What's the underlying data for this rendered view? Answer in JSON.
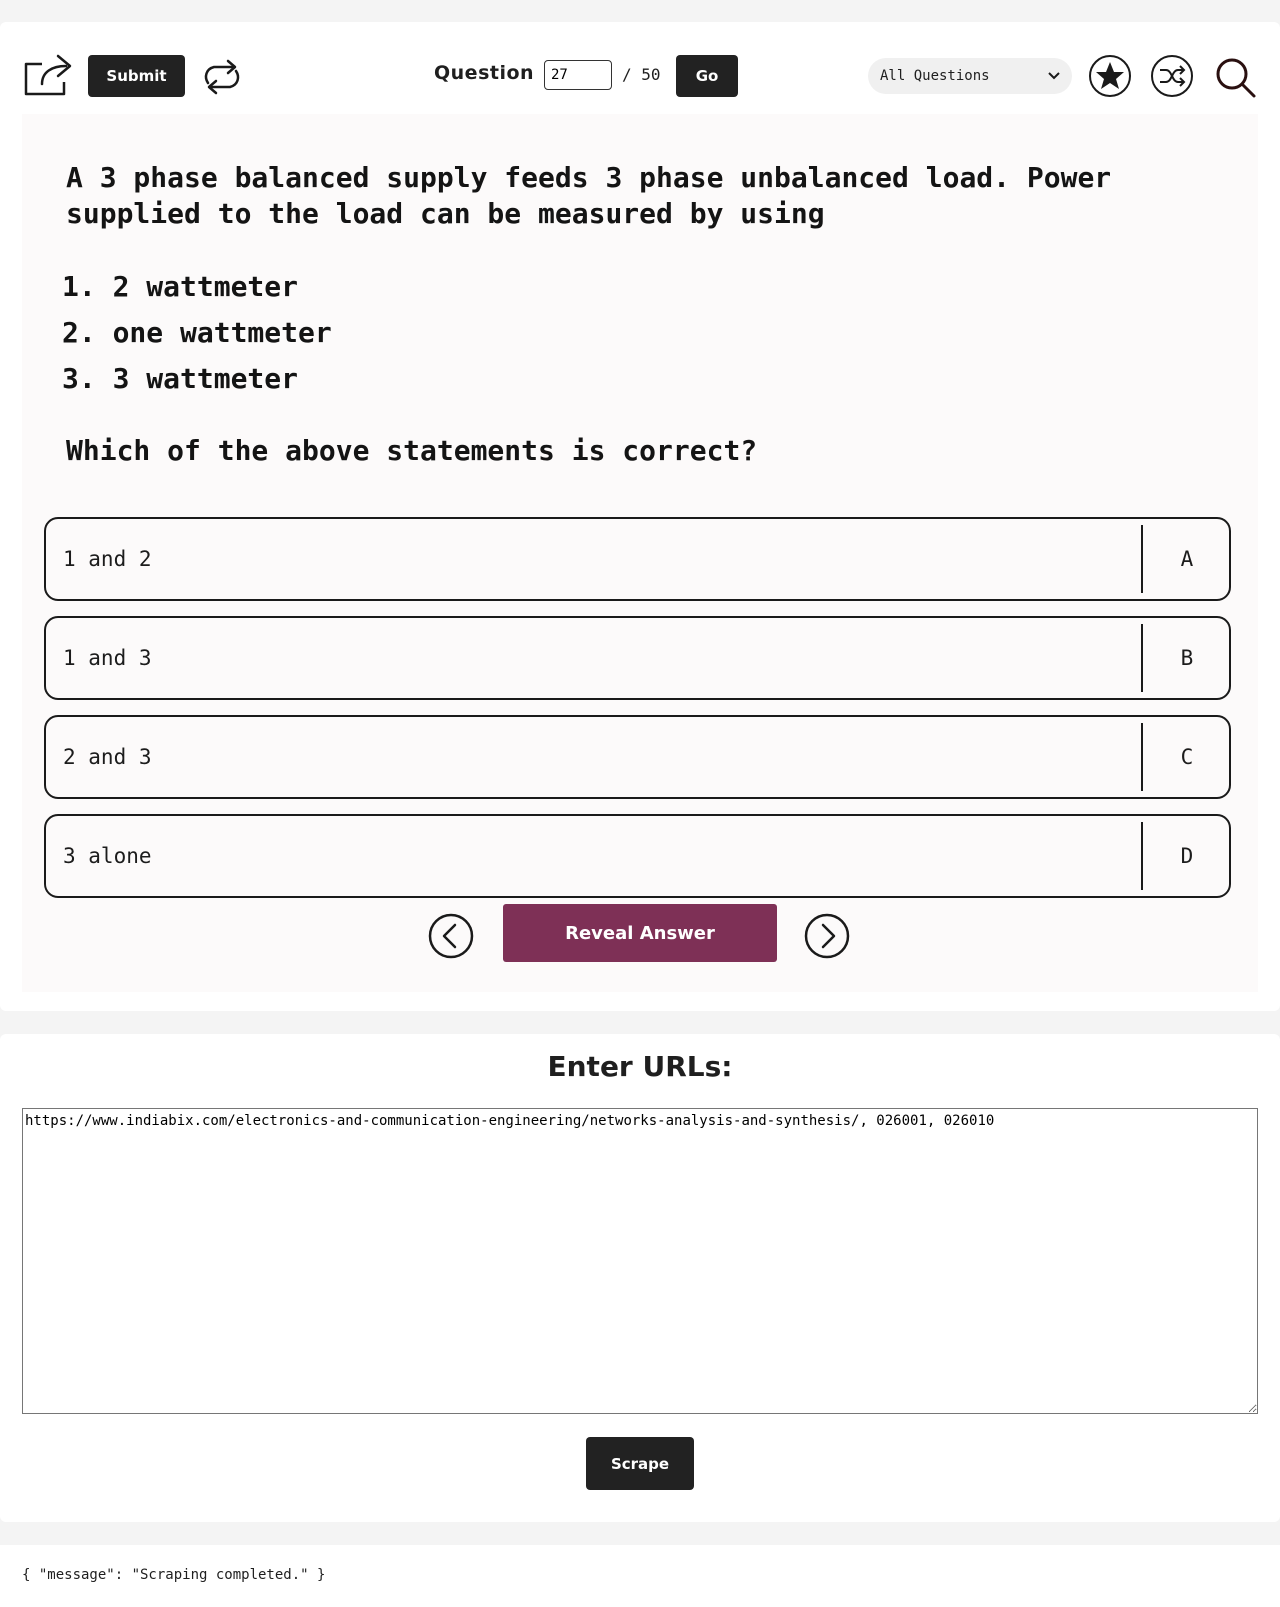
{
  "toolbar": {
    "submit_label": "Submit",
    "question_label": "Question",
    "current_question": "27",
    "total_label": "/ 50",
    "go_label": "Go",
    "filter_selected": "All Questions",
    "icons": {
      "share": "share-icon",
      "reset": "reset-icon",
      "star": "star-icon",
      "shuffle": "shuffle-icon",
      "search": "search-icon"
    }
  },
  "question": {
    "text": "A 3 phase balanced supply feeds 3 phase unbalanced load. Power supplied to the load can be measured by using",
    "statements": [
      "1. 2 wattmeter",
      "2. one wattmeter",
      "3. 3 wattmeter"
    ],
    "ask": "Which of the above statements is correct?",
    "options": [
      {
        "text": "1 and 2",
        "letter": "A"
      },
      {
        "text": "1 and 3",
        "letter": "B"
      },
      {
        "text": "2 and 3",
        "letter": "C"
      },
      {
        "text": "3 alone",
        "letter": "D"
      }
    ],
    "reveal_label": "Reveal Answer",
    "nav_icons": {
      "prev": "chevron-left-icon",
      "next": "chevron-right-icon"
    }
  },
  "scraper": {
    "title": "Enter URLs:",
    "urls_value": "https://www.indiabix.com/electronics-and-communication-engineering/networks-analysis-and-synthesis/, 026001, 026010",
    "scrape_label": "Scrape"
  },
  "response": {
    "text": "{ \"message\": \"Scraping completed.\" }"
  },
  "colors": {
    "reveal_button": "#7e3056",
    "dark_button": "#222222",
    "page_background": "#f4f4f4",
    "panel_background": "#fcfafa"
  }
}
